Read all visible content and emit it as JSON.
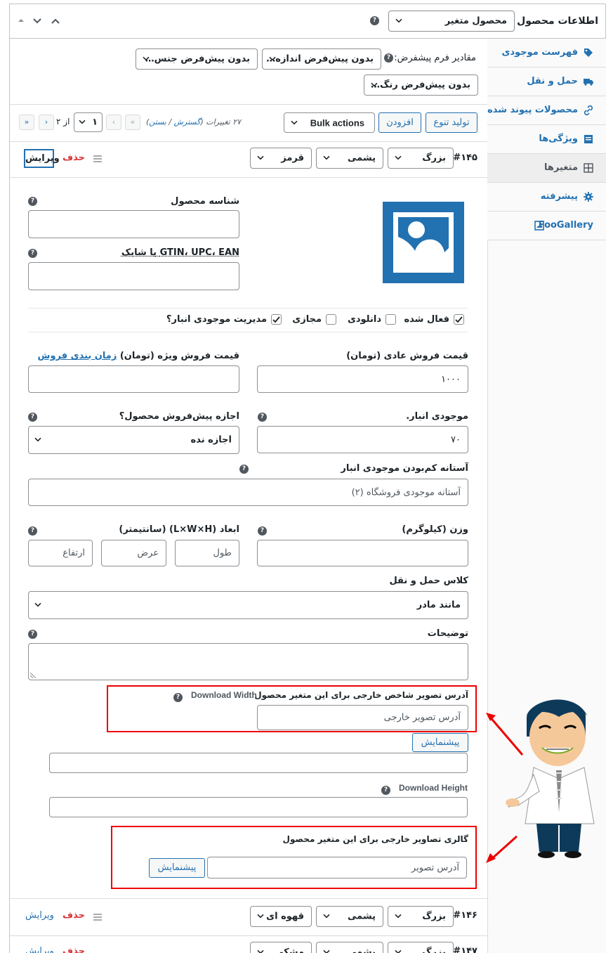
{
  "header": {
    "title": "اطلاعات محصول —",
    "product_type": "محصول متغیر"
  },
  "defaults": {
    "label": "مقادیر فرم پیشفرض:",
    "size": "بدون پیش‌فرض اندازه…",
    "gender": "بدون پیش‌فرض جنس…",
    "color": "بدون پیش‌فرض رنگ…"
  },
  "toolbar": {
    "generate": "تولید تنوع",
    "add": "افزودن",
    "bulk": "Bulk actions",
    "count": "۲۷ تغییرات (",
    "expand": "گسترش",
    "sep": " / ",
    "close": "بستن",
    "count_end": ")",
    "page": "۱",
    "of": "از ۲",
    "first": "«",
    "prev": "‹",
    "next": "›",
    "last": "»"
  },
  "variation": {
    "id": "#۱۴۵",
    "size": "بزرگ",
    "material": "پشمی",
    "color": "قرمز",
    "delete": "حذف",
    "edit": "ویرایش",
    "sku_label": "شناسه محصول",
    "gtin_label": "GTIN، UPC، EAN یا شابک",
    "enabled": "فعال شده",
    "downloadable": "دانلودی",
    "virtual": "مجازی",
    "manage_stock": "مدیریت موجودی انبار؟",
    "regular_price_label": "قیمت فروش عادی (تومان)",
    "regular_price": "۱۰۰۰",
    "sale_price_label": "قیمت فروش ویژه (تومان)",
    "schedule": "زمان بندی فروش",
    "stock_label": "موجودی انبار.",
    "stock": "۷۰",
    "backorder_label": "اجازه پیش‌فروش محصول؟",
    "backorder": "اجازه نده",
    "low_stock_label": "آستانه کم‌بودن موجودی انبار",
    "low_stock_placeholder": "آستانه موجودی فروشگاه (۲)",
    "weight_label": "وزن (کیلوگرم)",
    "dimensions_label": "ابعاد (L×W×H) (سانتیمتر)",
    "length": "طول",
    "width": "عرض",
    "height": "ارتفاع",
    "shipping_label": "کلاس حمل و نقل",
    "shipping": "مانند مادر",
    "desc_label": "توضیحات",
    "ext_image_label": "آدرس تصویر شاخص خارجی برای این متغیر محصول",
    "download_width": "Download Width",
    "ext_image_placeholder": "آدرس تصویر خارجی",
    "preview": "پیشنمایش",
    "download_height": "Download Height",
    "gallery_label": "گالری تصاویر خارجی برای این متغیر محصول",
    "gallery_placeholder": "آدرس تصویر",
    "gallery_preview": "پیشنمایش"
  },
  "variation2": {
    "id": "#۱۴۶",
    "size": "بزرگ",
    "material": "پشمی",
    "color": "قهوه ای",
    "delete": "حذف",
    "edit": "ویرایش"
  },
  "variation3": {
    "id": "#۱۴۷",
    "size": "بزرگ",
    "material": "پشمی",
    "color": "مشکی",
    "delete": "حذف",
    "edit": "ویرایش"
  },
  "sidebar": {
    "items": [
      {
        "label": "فهرست موجودی",
        "icon": "tag-icon"
      },
      {
        "label": "حمل و نقل",
        "icon": "truck-icon"
      },
      {
        "label": "محصولات پیوند شده",
        "icon": "link-icon"
      },
      {
        "label": "ویژگی‌ها",
        "icon": "list-icon"
      },
      {
        "label": "متغیرها",
        "icon": "grid-icon"
      },
      {
        "label": "پیشرفته",
        "icon": "gear-icon"
      },
      {
        "label": "FooGallery",
        "icon": "gallery-icon"
      }
    ]
  },
  "colors": {
    "accent": "#2271b1",
    "danger": "#d63638",
    "highlight": "#e00000"
  }
}
